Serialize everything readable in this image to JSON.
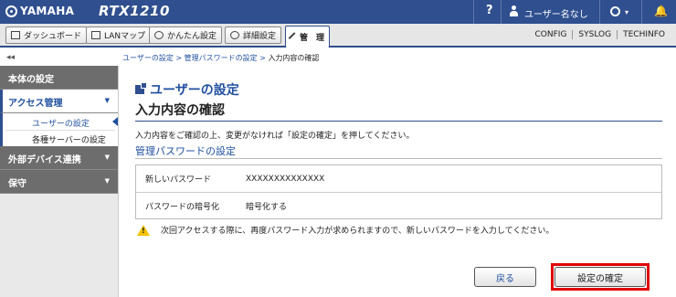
{
  "topbar": {
    "logo": "YAMAHA",
    "model": "RTX1210",
    "help": "?",
    "user": "ユーザー名なし",
    "caret": "▾",
    "bell": "🔔"
  },
  "navbar": {
    "buttons": [
      "ダッシュボード",
      "LANマップ",
      "かんたん設定",
      "詳細設定",
      "管　理"
    ],
    "links": [
      "CONFIG",
      "SYSLOG",
      "TECHINFO"
    ]
  },
  "breadcrumb": {
    "collapse": "◂◂",
    "items": [
      "ユーザーの設定",
      "管理パスワードの設定",
      "入力内容の確認"
    ],
    "sep": " > "
  },
  "sidebar": {
    "groups": [
      {
        "label": "本体の設定"
      },
      {
        "label": "アクセス管理",
        "arrow": "▼",
        "items": [
          "ユーザーの設定",
          "各種サーバーの設定"
        ]
      },
      {
        "label": "外部デバイス連携",
        "arrow": "▼"
      },
      {
        "label": "保守",
        "arrow": "▼"
      }
    ]
  },
  "main": {
    "heading": "ユーザーの設定",
    "subheading": "入力内容の確認",
    "intro": "入力内容をご確認の上、変更がなければ「設定の確定」を押してください。",
    "section": "管理パスワードの設定",
    "rows": [
      {
        "key": "新しいパスワード",
        "value": "XXXXXXXXXXXXXX"
      },
      {
        "key": "パスワードの暗号化",
        "value": "暗号化する"
      }
    ],
    "warning": "次回アクセスする際に、再度パスワード入力が求められますので、新しいパスワードを入力してください。",
    "back_button": "戻る",
    "confirm_button": "設定の確定"
  },
  "colors": {
    "brand": "#2f4f8f",
    "link": "#1f4f9f",
    "highlight": "#e00000",
    "warning": "#f2c200"
  }
}
